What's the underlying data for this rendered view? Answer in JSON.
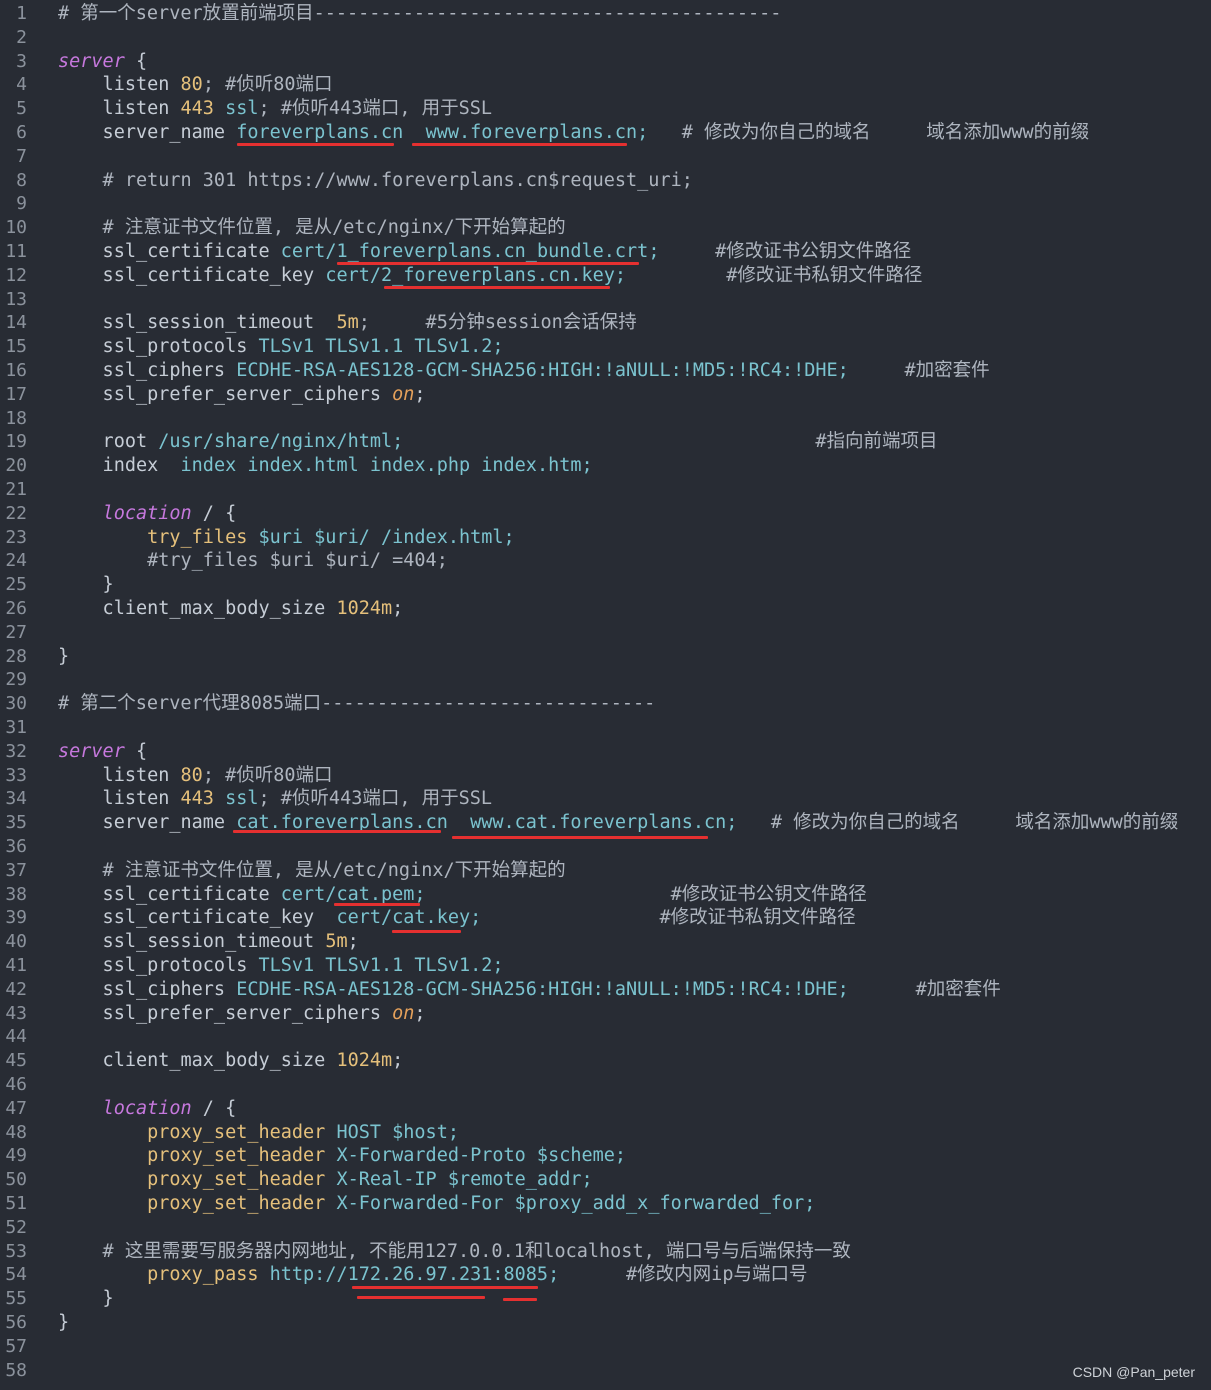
{
  "lines": [
    {
      "no": "1",
      "tokens": [
        {
          "t": "# 第一个server放置前端项目------------------------------------------",
          "c": "c"
        }
      ]
    },
    {
      "no": "2",
      "tokens": []
    },
    {
      "no": "3",
      "tokens": [
        {
          "t": "server",
          "c": "k"
        },
        {
          "t": " {",
          "c": "p"
        }
      ]
    },
    {
      "no": "4",
      "tokens": [
        {
          "t": "    listen ",
          "c": "d"
        },
        {
          "t": "80",
          "c": "n"
        },
        {
          "t": "; #侦听80端口",
          "c": "c"
        }
      ]
    },
    {
      "no": "5",
      "tokens": [
        {
          "t": "    listen ",
          "c": "d"
        },
        {
          "t": "443",
          "c": "n"
        },
        {
          "t": " ssl",
          "c": "v"
        },
        {
          "t": "; #侦听443端口, 用于SSL",
          "c": "c"
        }
      ]
    },
    {
      "no": "6",
      "tokens": [
        {
          "t": "    server_name ",
          "c": "d"
        },
        {
          "t": "foreverplans.cn  www.foreverplans.cn;",
          "c": "v"
        },
        {
          "t": "   # 修改为你自己的域名     域名添加www的前缀",
          "c": "c"
        }
      ]
    },
    {
      "no": "7",
      "tokens": []
    },
    {
      "no": "8",
      "tokens": [
        {
          "t": "    # return 301 https://www.foreverplans.cn$request_uri;",
          "c": "c"
        }
      ]
    },
    {
      "no": "9",
      "tokens": []
    },
    {
      "no": "10",
      "tokens": [
        {
          "t": "    # 注意证书文件位置, 是从/etc/nginx/下开始算起的",
          "c": "c"
        }
      ]
    },
    {
      "no": "11",
      "tokens": [
        {
          "t": "    ssl_certificate ",
          "c": "d"
        },
        {
          "t": "cert/1_foreverplans.cn_bundle.crt;",
          "c": "v"
        },
        {
          "t": "     #修改证书公钥文件路径",
          "c": "c"
        }
      ]
    },
    {
      "no": "12",
      "tokens": [
        {
          "t": "    ssl_certificate_key ",
          "c": "d"
        },
        {
          "t": "cert/2_foreverplans.cn.key;",
          "c": "v"
        },
        {
          "t": "         #修改证书私钥文件路径",
          "c": "c"
        }
      ]
    },
    {
      "no": "13",
      "tokens": []
    },
    {
      "no": "14",
      "tokens": [
        {
          "t": "    ssl_session_timeout  ",
          "c": "d"
        },
        {
          "t": "5m",
          "c": "n"
        },
        {
          "t": ";     #5分钟session会话保持",
          "c": "c"
        }
      ]
    },
    {
      "no": "15",
      "tokens": [
        {
          "t": "    ssl_protocols ",
          "c": "d"
        },
        {
          "t": "TLSv1 TLSv1.1 TLSv1.2;",
          "c": "v"
        }
      ]
    },
    {
      "no": "16",
      "tokens": [
        {
          "t": "    ssl_ciphers ",
          "c": "d"
        },
        {
          "t": "ECDHE-RSA-AES128-GCM-SHA256:HIGH:!aNULL:!MD5:!RC4:!DHE;",
          "c": "v"
        },
        {
          "t": "     #加密套件",
          "c": "c"
        }
      ]
    },
    {
      "no": "17",
      "tokens": [
        {
          "t": "    ssl_prefer_server_ciphers ",
          "c": "d"
        },
        {
          "t": "on",
          "c": "on"
        },
        {
          "t": ";",
          "c": "p"
        }
      ]
    },
    {
      "no": "18",
      "tokens": []
    },
    {
      "no": "19",
      "tokens": [
        {
          "t": "    root ",
          "c": "d"
        },
        {
          "t": "/usr/share/nginx/html;",
          "c": "v"
        },
        {
          "t": "                                     #指向前端项目",
          "c": "c"
        }
      ]
    },
    {
      "no": "20",
      "tokens": [
        {
          "t": "    index  ",
          "c": "d"
        },
        {
          "t": "index index.html index.php index.htm;",
          "c": "v"
        }
      ]
    },
    {
      "no": "21",
      "tokens": []
    },
    {
      "no": "22",
      "tokens": [
        {
          "t": "    ",
          "c": "d"
        },
        {
          "t": "location",
          "c": "k"
        },
        {
          "t": " / {",
          "c": "p"
        }
      ]
    },
    {
      "no": "23",
      "tokens": [
        {
          "t": "        try_files ",
          "c": "n"
        },
        {
          "t": "$uri $uri/ /index.html;",
          "c": "v"
        }
      ]
    },
    {
      "no": "24",
      "tokens": [
        {
          "t": "        #try_files $uri $uri/ =404;",
          "c": "c"
        }
      ]
    },
    {
      "no": "25",
      "tokens": [
        {
          "t": "    }",
          "c": "p"
        }
      ]
    },
    {
      "no": "26",
      "tokens": [
        {
          "t": "    client_max_body_size ",
          "c": "d"
        },
        {
          "t": "1024m",
          "c": "n"
        },
        {
          "t": ";",
          "c": "p"
        }
      ]
    },
    {
      "no": "27",
      "tokens": []
    },
    {
      "no": "28",
      "tokens": [
        {
          "t": "}",
          "c": "p"
        }
      ]
    },
    {
      "no": "29",
      "tokens": []
    },
    {
      "no": "30",
      "tokens": [
        {
          "t": "# 第二个server代理8085端口------------------------------",
          "c": "c"
        }
      ]
    },
    {
      "no": "31",
      "tokens": []
    },
    {
      "no": "32",
      "tokens": [
        {
          "t": "server",
          "c": "k"
        },
        {
          "t": " {",
          "c": "p"
        }
      ]
    },
    {
      "no": "33",
      "tokens": [
        {
          "t": "    listen ",
          "c": "d"
        },
        {
          "t": "80",
          "c": "n"
        },
        {
          "t": "; #侦听80端口",
          "c": "c"
        }
      ]
    },
    {
      "no": "34",
      "tokens": [
        {
          "t": "    listen ",
          "c": "d"
        },
        {
          "t": "443",
          "c": "n"
        },
        {
          "t": " ssl",
          "c": "v"
        },
        {
          "t": "; #侦听443端口, 用于SSL",
          "c": "c"
        }
      ]
    },
    {
      "no": "35",
      "tokens": [
        {
          "t": "    server_name ",
          "c": "d"
        },
        {
          "t": "cat.foreverplans.cn  www.cat.foreverplans.cn;",
          "c": "v"
        },
        {
          "t": "   # 修改为你自己的域名     域名添加www的前缀",
          "c": "c"
        }
      ]
    },
    {
      "no": "36",
      "tokens": []
    },
    {
      "no": "37",
      "tokens": [
        {
          "t": "    # 注意证书文件位置, 是从/etc/nginx/下开始算起的",
          "c": "c"
        }
      ]
    },
    {
      "no": "38",
      "tokens": [
        {
          "t": "    ssl_certificate ",
          "c": "d"
        },
        {
          "t": "cert/cat.pem;",
          "c": "v"
        },
        {
          "t": "                      #修改证书公钥文件路径",
          "c": "c"
        }
      ]
    },
    {
      "no": "39",
      "tokens": [
        {
          "t": "    ssl_certificate_key  ",
          "c": "d"
        },
        {
          "t": "cert/cat.key;",
          "c": "v"
        },
        {
          "t": "                #修改证书私钥文件路径",
          "c": "c"
        }
      ]
    },
    {
      "no": "40",
      "tokens": [
        {
          "t": "    ssl_session_timeout ",
          "c": "d"
        },
        {
          "t": "5m",
          "c": "n"
        },
        {
          "t": ";",
          "c": "p"
        }
      ]
    },
    {
      "no": "41",
      "tokens": [
        {
          "t": "    ssl_protocols ",
          "c": "d"
        },
        {
          "t": "TLSv1 TLSv1.1 TLSv1.2;",
          "c": "v"
        }
      ]
    },
    {
      "no": "42",
      "tokens": [
        {
          "t": "    ssl_ciphers ",
          "c": "d"
        },
        {
          "t": "ECDHE-RSA-AES128-GCM-SHA256:HIGH:!aNULL:!MD5:!RC4:!DHE;",
          "c": "v"
        },
        {
          "t": "      #加密套件",
          "c": "c"
        }
      ]
    },
    {
      "no": "43",
      "tokens": [
        {
          "t": "    ssl_prefer_server_ciphers ",
          "c": "d"
        },
        {
          "t": "on",
          "c": "on"
        },
        {
          "t": ";",
          "c": "p"
        }
      ]
    },
    {
      "no": "44",
      "tokens": []
    },
    {
      "no": "45",
      "tokens": [
        {
          "t": "    client_max_body_size ",
          "c": "d"
        },
        {
          "t": "1024m",
          "c": "n"
        },
        {
          "t": ";",
          "c": "p"
        }
      ]
    },
    {
      "no": "46",
      "tokens": []
    },
    {
      "no": "47",
      "tokens": [
        {
          "t": "    ",
          "c": "d"
        },
        {
          "t": "location",
          "c": "k"
        },
        {
          "t": " / {",
          "c": "p"
        }
      ]
    },
    {
      "no": "48",
      "tokens": [
        {
          "t": "        proxy_set_header ",
          "c": "n"
        },
        {
          "t": "HOST $host;",
          "c": "v"
        }
      ]
    },
    {
      "no": "49",
      "tokens": [
        {
          "t": "        proxy_set_header ",
          "c": "n"
        },
        {
          "t": "X-Forwarded-Proto $scheme;",
          "c": "v"
        }
      ]
    },
    {
      "no": "50",
      "tokens": [
        {
          "t": "        proxy_set_header ",
          "c": "n"
        },
        {
          "t": "X-Real-IP $remote_addr;",
          "c": "v"
        }
      ]
    },
    {
      "no": "51",
      "tokens": [
        {
          "t": "        proxy_set_header ",
          "c": "n"
        },
        {
          "t": "X-Forwarded-For $proxy_add_x_forwarded_for;",
          "c": "v"
        }
      ]
    },
    {
      "no": "52",
      "tokens": []
    },
    {
      "no": "53",
      "tokens": [
        {
          "t": "    # 这里需要写服务器内网地址, 不能用127.0.0.1和localhost, 端口号与后端保持一致",
          "c": "c"
        }
      ]
    },
    {
      "no": "54",
      "tokens": [
        {
          "t": "        proxy_pass ",
          "c": "n"
        },
        {
          "t": "http://172.26.97.231:8085;",
          "c": "v"
        },
        {
          "t": "      #修改内网ip与端口号",
          "c": "c"
        }
      ]
    },
    {
      "no": "55",
      "tokens": [
        {
          "t": "    }",
          "c": "p"
        }
      ]
    },
    {
      "no": "56",
      "tokens": [
        {
          "t": "}",
          "c": "p"
        }
      ]
    },
    {
      "no": "57",
      "tokens": []
    },
    {
      "no": "58",
      "tokens": []
    }
  ],
  "colors": {
    "background": "#282c34",
    "underline": "#e53030"
  },
  "watermark": "CSDN @Pan_peter"
}
